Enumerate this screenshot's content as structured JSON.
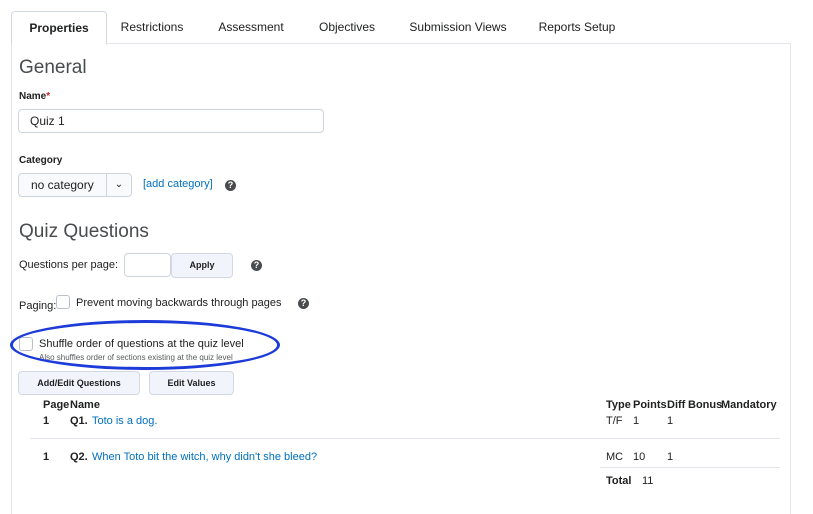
{
  "tabs": [
    {
      "label": "Properties",
      "active": true
    },
    {
      "label": "Restrictions"
    },
    {
      "label": "Assessment"
    },
    {
      "label": "Objectives"
    },
    {
      "label": "Submission Views"
    },
    {
      "label": "Reports Setup"
    }
  ],
  "general": {
    "heading": "General",
    "name_label": "Name",
    "required_marker": "*",
    "name_value": "Quiz 1",
    "category_label": "Category",
    "category_value": "no category",
    "add_category_link": "[add category]"
  },
  "quiz_questions": {
    "heading": "Quiz Questions",
    "per_page_label": "Questions per page:",
    "per_page_value": "",
    "apply_button": "Apply",
    "paging_label": "Paging:",
    "prevent_back_label": "Prevent moving backwards through pages",
    "shuffle_label": "Shuffle order of questions at the quiz level",
    "shuffle_hint": "Also shuffles order of sections existing at the quiz level",
    "add_edit_button": "Add/Edit Questions",
    "edit_values_button": "Edit Values"
  },
  "table": {
    "columns": [
      "Page",
      "Name",
      "Type",
      "Points",
      "Diff",
      "Bonus",
      "Mandatory"
    ],
    "rows": [
      {
        "page": "1",
        "qnum": "Q1.",
        "name": "Toto is a dog.",
        "type": "T/F",
        "points": "1",
        "diff": "1"
      },
      {
        "page": "1",
        "qnum": "Q2.",
        "name": "When Toto bit the witch, why didn't she bleed?",
        "type": "MC",
        "points": "10",
        "diff": "1"
      }
    ],
    "total_label": "Total",
    "total_value": "11"
  },
  "help_glyph": "?",
  "colors": {
    "link": "#006fbf",
    "highlight": "#1c3bd8"
  }
}
